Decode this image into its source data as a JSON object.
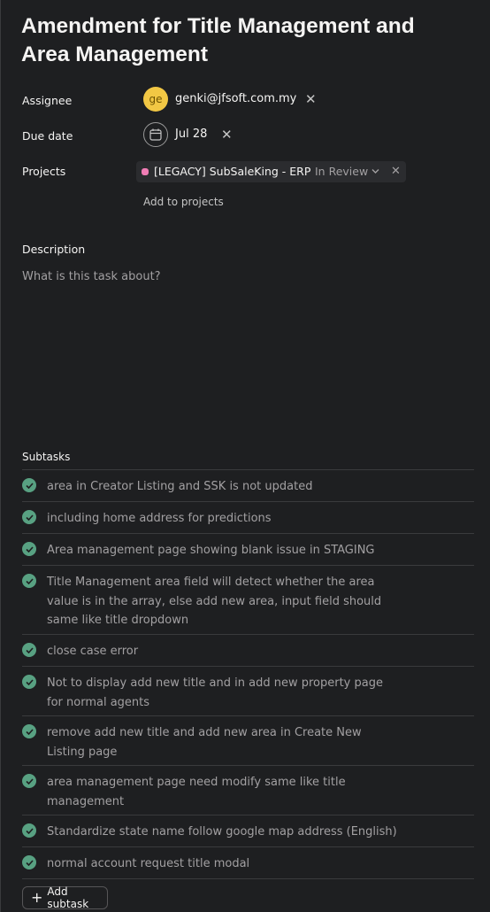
{
  "task": {
    "title": "Amendment for Title Management and Area Management"
  },
  "fields": {
    "assignee_label": "Assignee",
    "assignee_initials": "ge",
    "assignee_email": "genki@jfsoft.com.my",
    "due_label": "Due date",
    "due_value": "Jul 28",
    "projects_label": "Projects",
    "project_name": "[LEGACY] SubSaleKing - ERP",
    "project_status": "In Review",
    "add_projects_label": "Add to projects",
    "remove_symbol": "✕"
  },
  "description": {
    "label": "Description",
    "placeholder": "What is this task about?"
  },
  "subtasks": {
    "label": "Subtasks",
    "items": [
      {
        "text": "area in Creator Listing and SSK is not updated",
        "completed": true
      },
      {
        "text": "including home address for predictions",
        "completed": true
      },
      {
        "text": "Area management page showing blank issue in STAGING",
        "completed": true
      },
      {
        "text": "Title Management area field will detect whether the area value is in the array, else add new area, input field should same like title dropdown",
        "completed": true
      },
      {
        "text": "close case error",
        "completed": true
      },
      {
        "text": "Not to display add new title and in add new property page for normal agents",
        "completed": true
      },
      {
        "text": "remove add new title and add new area in Create New Listing page",
        "completed": true
      },
      {
        "text": "area management page need modify same like title management",
        "completed": true
      },
      {
        "text": "Standardize state name follow google map address (English)",
        "completed": true
      },
      {
        "text": "normal account request title modal",
        "completed": true
      }
    ],
    "add_label": "Add subtask"
  },
  "colors": {
    "background": "#1e1f21",
    "check_green": "#58a182",
    "avatar_yellow": "#f2c744",
    "project_pink": "#f07db5"
  },
  "icons": [
    "calendar-icon",
    "close-icon",
    "chevron-down-icon",
    "check-icon",
    "plus-icon"
  ]
}
